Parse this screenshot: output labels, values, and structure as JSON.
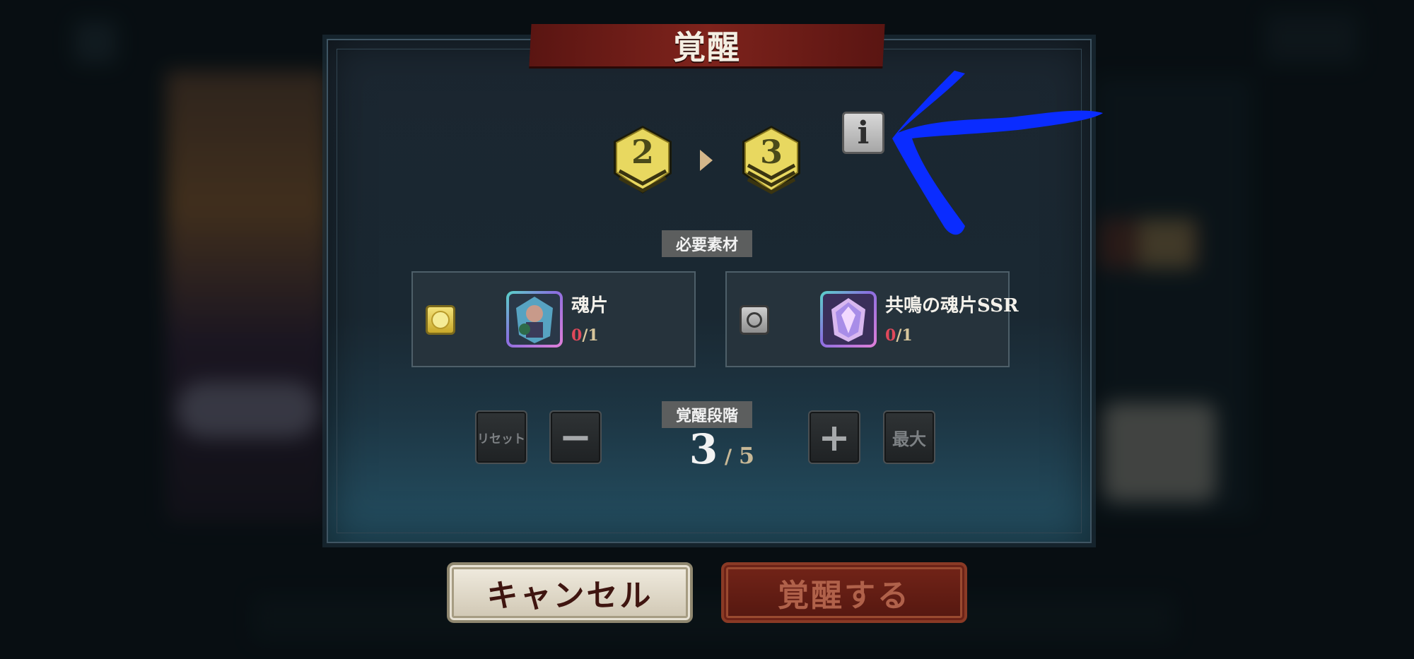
{
  "dialog": {
    "title": "覚醒"
  },
  "rank": {
    "current": "2",
    "next": "3"
  },
  "info_button": {
    "label": "i"
  },
  "materials": {
    "header": "必要素材",
    "items": [
      {
        "name": "魂片",
        "have": "0",
        "sep": "/",
        "need": "1",
        "selected": true
      },
      {
        "name": "共鳴の魂片SSR",
        "have": "0",
        "sep": "/",
        "need": "1",
        "selected": false
      }
    ]
  },
  "stage": {
    "header": "覚醒段階",
    "current": "3",
    "sep": "/",
    "max": "5",
    "reset_label": "リセット",
    "minus_label": "−",
    "plus_label": "+",
    "max_label": "最大"
  },
  "buttons": {
    "cancel": "キャンセル",
    "awaken": "覚醒する"
  },
  "colors": {
    "title_banner": "#7e231c",
    "badge_gold": "#e8d860",
    "annotation_arrow": "#0a2cff",
    "count_have": "#e0485a"
  }
}
